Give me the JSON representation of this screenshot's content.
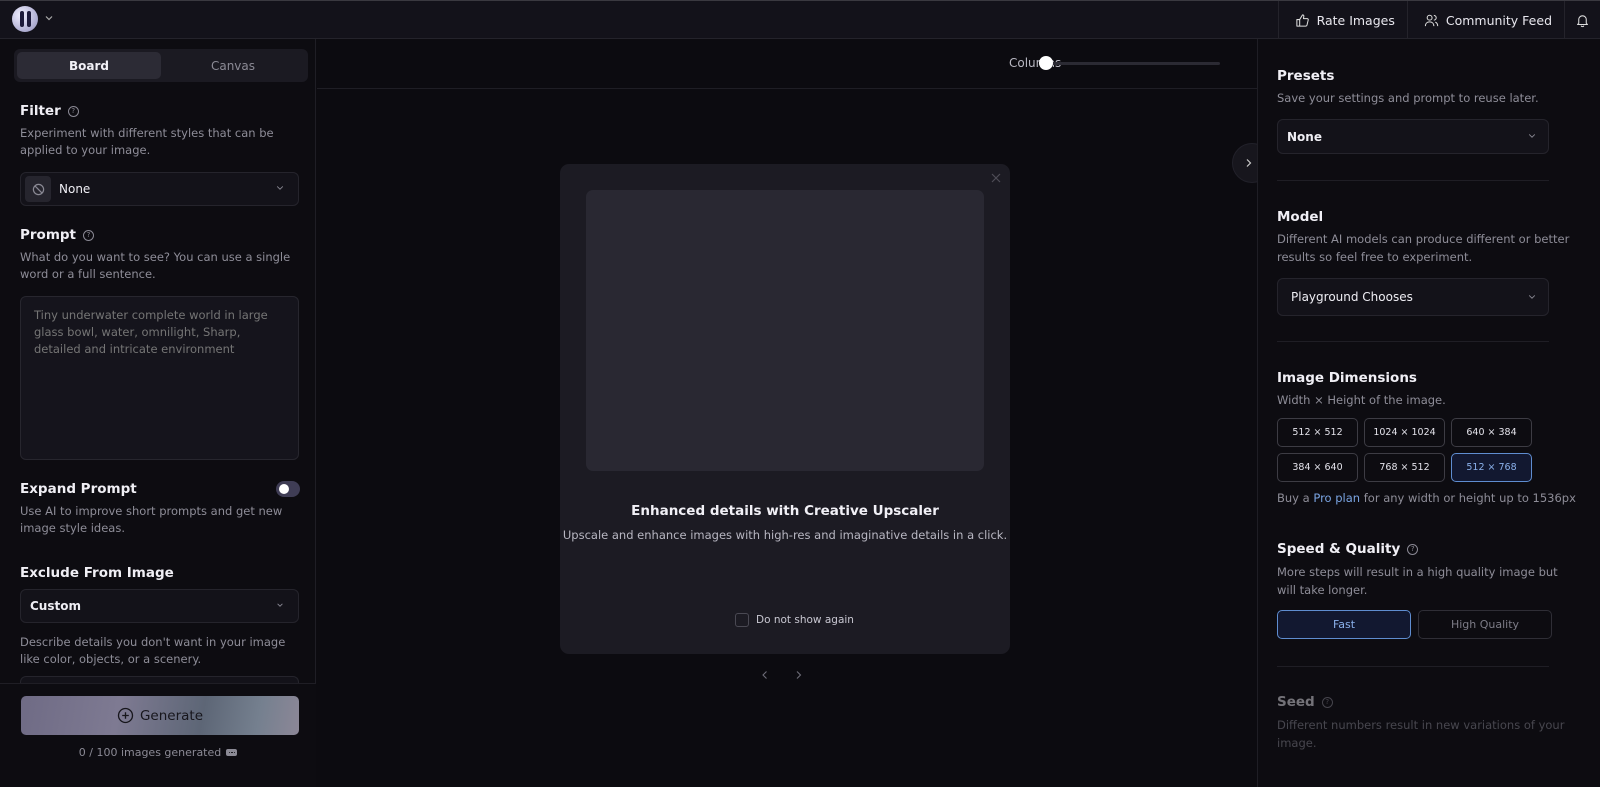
{
  "header": {
    "rate_images": "Rate Images",
    "community_feed": "Community Feed"
  },
  "left": {
    "tabs": [
      {
        "label": "Board",
        "active": true
      },
      {
        "label": "Canvas",
        "active": false
      }
    ],
    "filter": {
      "title": "Filter",
      "description": "Experiment with different styles that can be applied to your image.",
      "value": "None"
    },
    "prompt": {
      "title": "Prompt",
      "description": "What do you want to see? You can use a single word or a full sentence.",
      "placeholder": "Tiny underwater complete world in large glass bowl, water, omnilight, Sharp, detailed and intricate environment",
      "value": ""
    },
    "expand_prompt": {
      "title": "Expand Prompt",
      "description": "Use AI to improve short prompts and get new image style ideas.",
      "enabled": false
    },
    "exclude": {
      "title": "Exclude From Image",
      "value": "Custom",
      "description": "Describe details you don't want in your image like color, objects, or a scenery."
    },
    "generate_label": "Generate",
    "generated_count": "0 / 100 images generated"
  },
  "center": {
    "columns_label": "Columns",
    "columns_value": 0,
    "modal": {
      "title": "Enhanced details with Creative Upscaler",
      "description": "Upscale and enhance images with high-res and imaginative details in a click.",
      "checkbox_label": "Do not show again",
      "checked": false
    }
  },
  "right": {
    "presets": {
      "title": "Presets",
      "description": "Save your settings and prompt to reuse later.",
      "value": "None"
    },
    "model": {
      "title": "Model",
      "description": "Different AI models can produce different or better results so feel free to experiment.",
      "value": "Playground Chooses"
    },
    "dimensions": {
      "title": "Image Dimensions",
      "description": "Width × Height of the image.",
      "options": [
        "512 × 512",
        "1024 × 1024",
        "640 × 384",
        "384 × 640",
        "768 × 512",
        "512 × 768"
      ],
      "selected": "512 × 768",
      "note_prefix": "Buy a ",
      "note_link": "Pro plan",
      "note_suffix": " for any width or height up to 1536px"
    },
    "speed_quality": {
      "title": "Speed & Quality",
      "description": "More steps will result in a high quality image but will take longer.",
      "options": [
        "Fast",
        "High Quality"
      ],
      "selected": "Fast"
    },
    "seed": {
      "title": "Seed",
      "description": "Different numbers result in new variations of your image."
    }
  },
  "colors": {
    "accent": "#5f8dd0",
    "background": "#0c0b10",
    "panel": "#1c1b23"
  }
}
